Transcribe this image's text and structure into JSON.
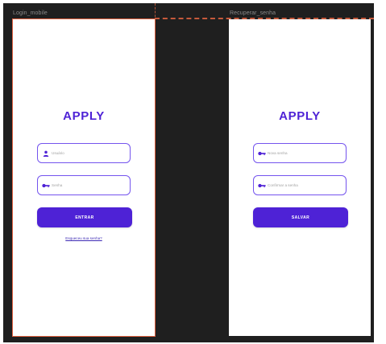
{
  "frames": {
    "login": {
      "title": "Login_mobile",
      "app_title": "APPLY",
      "username_placeholder": "Usuário",
      "password_placeholder": "Senha",
      "submit_label": "ENTRAR",
      "forgot_link": "Esqueceu sua senha?",
      "icons": [
        "user-icon",
        "key-icon"
      ]
    },
    "recover": {
      "title": "Recuperar_senha",
      "app_title": "APPLY",
      "new_password_placeholder": "Nova senha",
      "confirm_password_placeholder": "Confirmar a senha",
      "submit_label": "SALVAR",
      "icons": [
        "key-icon",
        "key-icon"
      ]
    }
  },
  "colors": {
    "workspace_bg": "#1f1f1f",
    "accent": "#4e22d6",
    "field_border": "#7454ee",
    "selection": "#e0603f"
  }
}
